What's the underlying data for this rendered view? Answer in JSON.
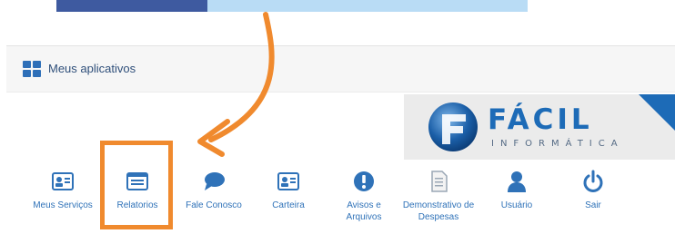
{
  "app_bar": {
    "title": "Meus aplicativos"
  },
  "logo": {
    "word": "FÁCIL",
    "sub": "INFORMÁTICA"
  },
  "menu": [
    {
      "label": "Meus Serviços",
      "icon": "id-card-icon"
    },
    {
      "label": "Relatorios",
      "icon": "report-icon"
    },
    {
      "label": "Fale Conosco",
      "icon": "speech-bubble-icon"
    },
    {
      "label": "Carteira",
      "icon": "id-card-icon"
    },
    {
      "label": "Avisos e Arquivos",
      "icon": "exclamation-icon"
    },
    {
      "label": "Demonstrativo de Despesas",
      "icon": "document-icon"
    },
    {
      "label": "Usuário",
      "icon": "user-icon"
    },
    {
      "label": "Sair",
      "icon": "power-icon"
    }
  ],
  "colors": {
    "accent": "#2f72b8",
    "highlight": "#f08a2e",
    "bar_dark": "#3e5aa0",
    "bar_light": "#b9dcf5"
  }
}
